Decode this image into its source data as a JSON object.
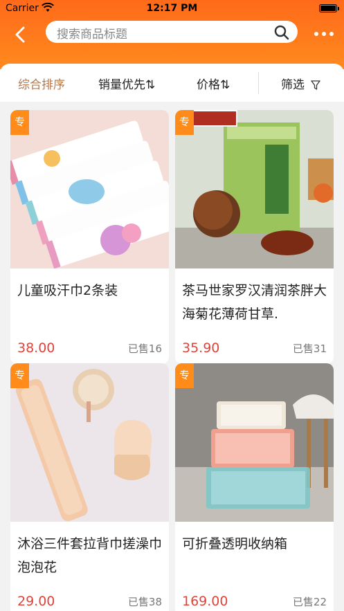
{
  "status_bar": {
    "carrier": "Carrier",
    "time": "12:17 PM"
  },
  "header": {
    "search_placeholder": "搜索商品标题",
    "icons": {
      "back": "chevron-left-icon",
      "search": "search-icon",
      "more": "more-dots-icon"
    }
  },
  "sort": {
    "items": [
      {
        "label": "综合排序",
        "active": true
      },
      {
        "label": "销量优先⇅",
        "active": false
      },
      {
        "label": "价格⇅",
        "active": false
      },
      {
        "label": "筛选",
        "active": false
      }
    ],
    "accent_color": "#b8784a"
  },
  "products": [
    {
      "tag": "专",
      "title": "儿童吸汗巾2条装",
      "price": "38.00",
      "sold": "已售16"
    },
    {
      "tag": "专",
      "title": "茶马世家罗汉清润茶胖大海菊花薄荷甘草.",
      "price": "35.90",
      "sold": "已售31"
    },
    {
      "tag": "专",
      "title": "沐浴三件套拉背巾搓澡巾泡泡花",
      "price": "29.00",
      "sold": "已售38"
    },
    {
      "tag": "专",
      "title": "可折叠透明收纳箱",
      "price": "169.00",
      "sold": "已售22"
    }
  ],
  "colors": {
    "header": "#ff6a1a",
    "price": "#e0433a",
    "tag": "#ff8c1a"
  }
}
